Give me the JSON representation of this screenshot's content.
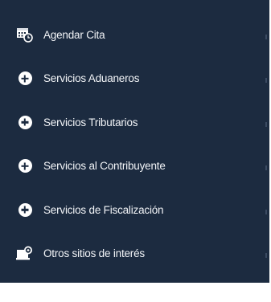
{
  "menu": {
    "items": [
      {
        "label": "Agendar Cita",
        "icon": "calendar-clock-icon"
      },
      {
        "label": "Servicios Aduaneros",
        "icon": "plus-circle-icon"
      },
      {
        "label": "Servicios Tributarios",
        "icon": "plus-circle-icon"
      },
      {
        "label": "Servicios al Contribuyente",
        "icon": "plus-circle-icon"
      },
      {
        "label": "Servicios de Fiscalización",
        "icon": "plus-circle-icon"
      },
      {
        "label": "Otros sitios de interés",
        "icon": "monitor-link-icon"
      }
    ]
  },
  "colors": {
    "sidebar_bg": "#1c2b40",
    "text": "#f2f4f7",
    "icon": "#ffffff"
  }
}
